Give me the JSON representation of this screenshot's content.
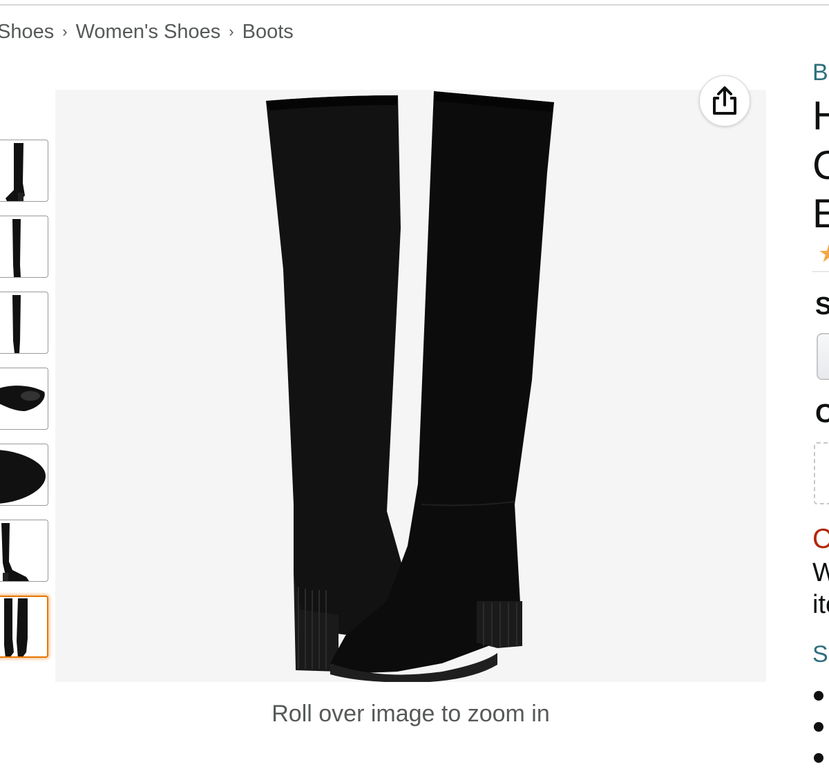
{
  "breadcrumb": {
    "items": [
      "Shoes",
      "Women's Shoes",
      "Boots"
    ],
    "separator": "›"
  },
  "gallery": {
    "thumbnail_count": 7,
    "active_thumbnail": 7,
    "thumbnails": [
      {
        "view": "boot-side"
      },
      {
        "view": "boot-front"
      },
      {
        "view": "boot-back"
      },
      {
        "view": "boot-sole"
      },
      {
        "view": "boot-top"
      },
      {
        "view": "boot-pair-side"
      },
      {
        "view": "boot-pair-front"
      }
    ],
    "zoom_hint": "Roll over image to zoom in",
    "share_icon": "share-icon"
  },
  "right_panel": {
    "brand_fragment": "B",
    "title_line1_fragment": "H",
    "title_line2_fragment": "C",
    "title_line3_fragment": "E",
    "size_label_fragment": "S",
    "color_label_fragment": "C",
    "deal_fragment": "C",
    "text_line1_fragment": "W",
    "text_line2_fragment": "ite",
    "link_fragment": "Si"
  },
  "colors": {
    "accent_orange": "#e77600",
    "link_teal": "#2f6f7e",
    "deal_red": "#b12704",
    "star": "#f3a847",
    "text_gray": "#565959"
  }
}
